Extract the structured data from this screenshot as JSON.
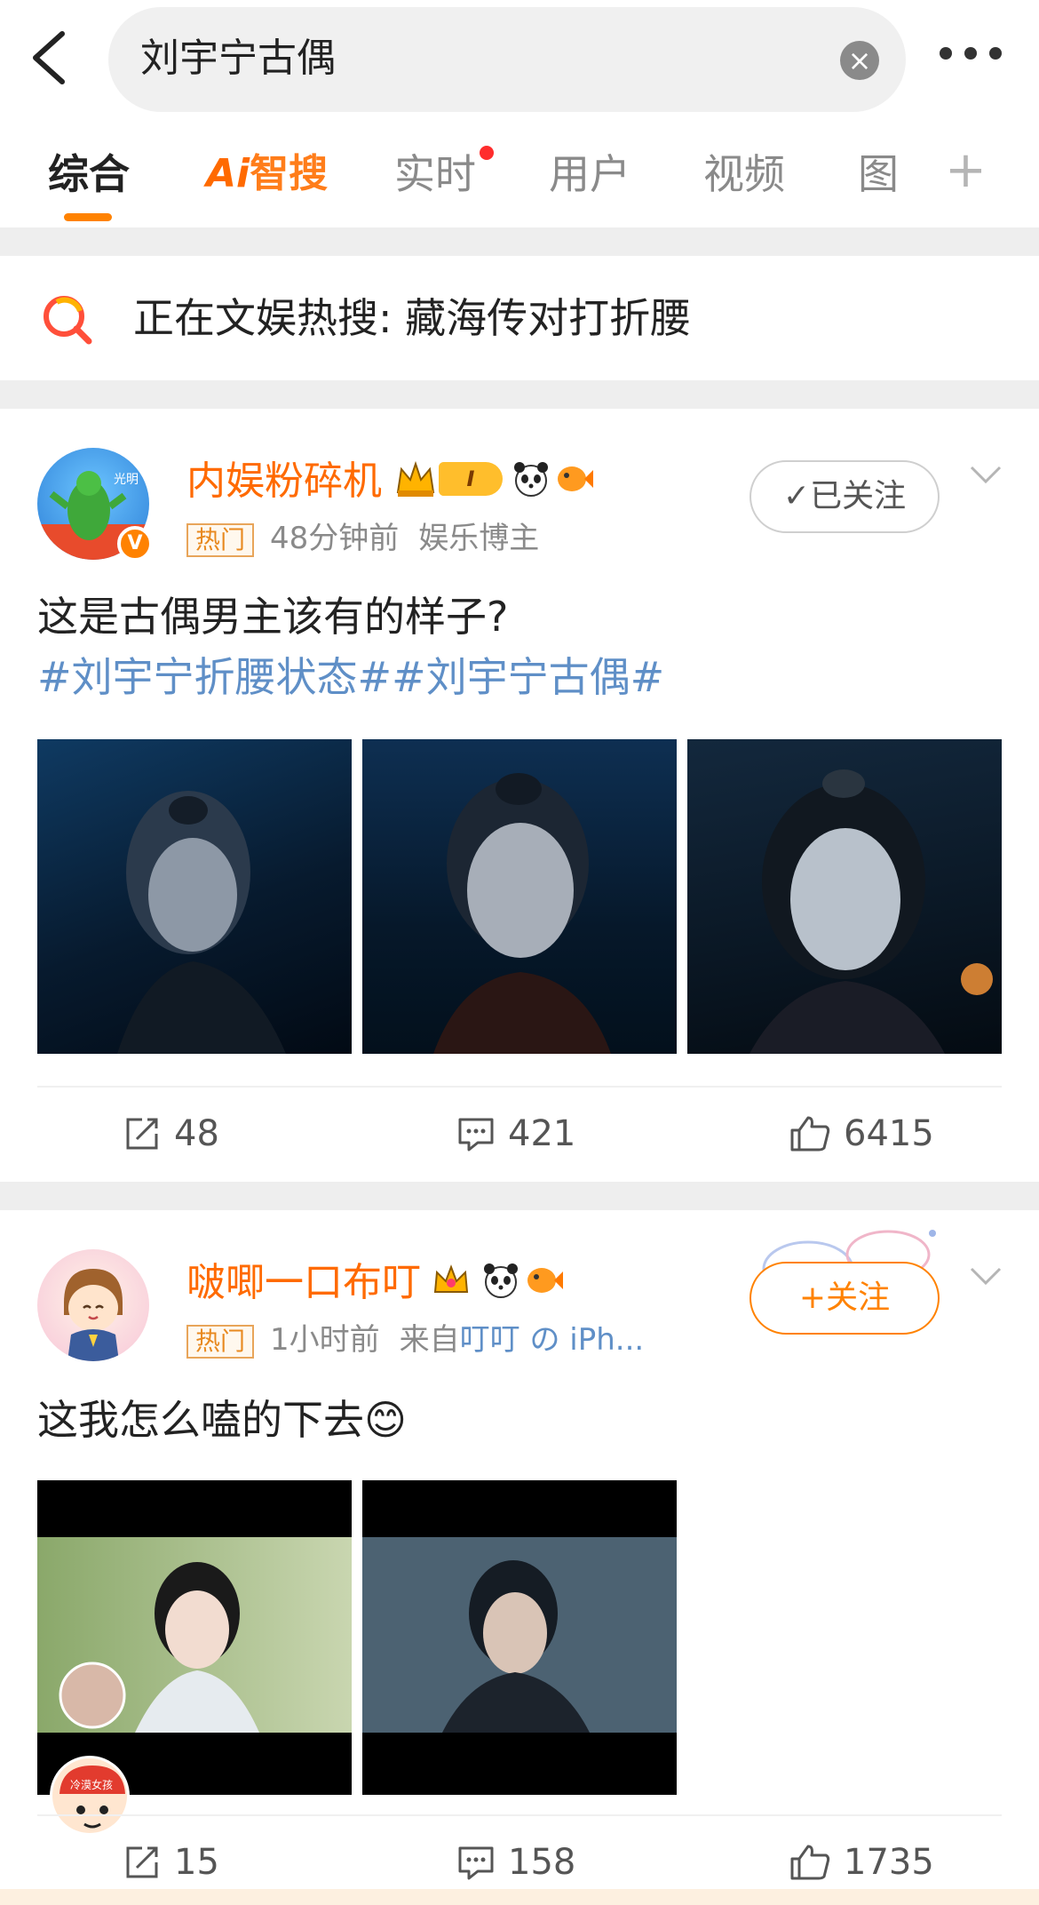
{
  "search": {
    "query": "刘宇宁古偶"
  },
  "tabs": [
    {
      "label": "综合"
    },
    {
      "label_ai": "Ai",
      "label_zs": "智搜"
    },
    {
      "label": "实时"
    },
    {
      "label": "用户"
    },
    {
      "label": "视频"
    },
    {
      "label": "图"
    },
    {
      "label": "+"
    }
  ],
  "hot_banner": {
    "text": "正在文娱热搜: 藏海传对打折腰"
  },
  "posts": [
    {
      "username": "内娱粉碎机",
      "avatar_text": "光明",
      "level_badge": "I",
      "hot_tag": "热门",
      "time": "48分钟前",
      "identity": "娱乐博主",
      "follow_label": "✓已关注",
      "text": "这是古偶男主该有的样子?",
      "hashtags": "#刘宇宁折腰状态##刘宇宁古偶#",
      "actions": {
        "reposts": "48",
        "comments": "421",
        "likes": "6415"
      }
    },
    {
      "username": "啵唧一口布叮",
      "hot_tag": "热门",
      "time": "1小时前",
      "from_prefix": "来自",
      "source": "叮叮 の iPh...",
      "follow_label": "+关注",
      "text": "这我怎么嗑的下去",
      "emoji": "😊",
      "sticker_text": "冷漠女孩",
      "actions": {
        "reposts": "15",
        "comments": "158",
        "likes": "1735"
      }
    }
  ],
  "colors": {
    "accent": "#ff8200",
    "link": "#5f8fc7",
    "username": "#ff6a00"
  }
}
